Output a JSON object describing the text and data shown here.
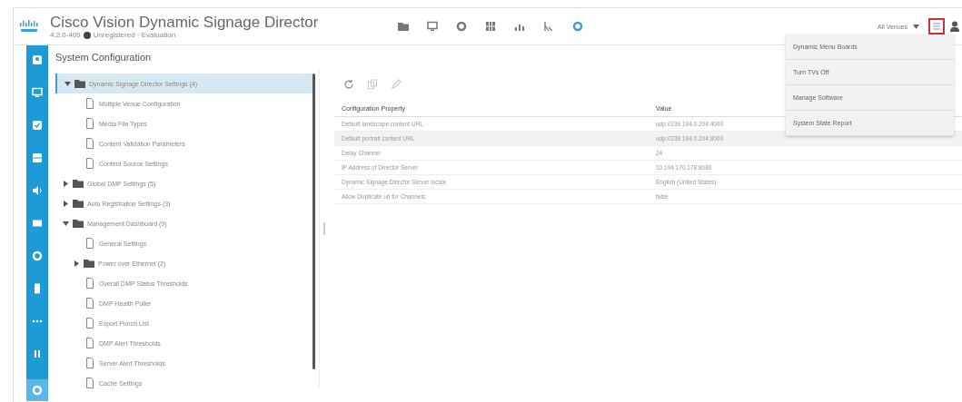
{
  "header": {
    "title": "Cisco Vision Dynamic Signage Director",
    "version": "4.2.0-409",
    "license": "Unregistered · Evaluation",
    "venue_selector": "All Venues"
  },
  "nav_icons": [
    {
      "kind": "folder",
      "selected": false
    },
    {
      "kind": "display",
      "selected": false
    },
    {
      "kind": "gear",
      "selected": false
    },
    {
      "kind": "grid",
      "selected": false
    },
    {
      "kind": "chart",
      "selected": false
    },
    {
      "kind": "signal",
      "selected": false
    },
    {
      "kind": "ring",
      "selected": true
    }
  ],
  "sidebar_icons": [
    {
      "kind": "user",
      "selected": false
    },
    {
      "kind": "display",
      "selected": false
    },
    {
      "kind": "check",
      "selected": false
    },
    {
      "kind": "box",
      "selected": false
    },
    {
      "kind": "sound",
      "selected": false
    },
    {
      "kind": "card",
      "selected": false
    },
    {
      "kind": "ring",
      "selected": false
    },
    {
      "kind": "phone",
      "selected": false
    },
    {
      "kind": "dots",
      "selected": false
    },
    {
      "kind": "pause",
      "selected": false
    },
    {
      "kind": "ring",
      "selected": true
    }
  ],
  "page_title": "System Configuration",
  "tree": [
    {
      "kind": "folder",
      "label": "Dynamic Signage Director Settings (4)",
      "expanded": true,
      "selected": true,
      "children": [
        {
          "kind": "file",
          "label": "Multiple Venue Configuration",
          "selected": false
        },
        {
          "kind": "file",
          "label": "Media File Types",
          "selected": false
        },
        {
          "kind": "file",
          "label": "Content Validation Parameters",
          "selected": false
        },
        {
          "kind": "file",
          "label": "Content Source Settings",
          "selected": false
        }
      ]
    },
    {
      "kind": "folder",
      "label": "Global DMP Settings (5)",
      "expanded": false,
      "selected": false
    },
    {
      "kind": "folder",
      "label": "Auto Registration Settings (3)",
      "expanded": false,
      "selected": false
    },
    {
      "kind": "folder",
      "label": "Management Dashboard (9)",
      "expanded": true,
      "selected": false,
      "children": [
        {
          "kind": "file",
          "label": "General Settings",
          "selected": false
        },
        {
          "kind": "folder",
          "label": "Power over Ethernet (2)",
          "expanded": false,
          "selected": false
        },
        {
          "kind": "file",
          "label": "Overall DMP Status Thresholds",
          "selected": false
        },
        {
          "kind": "file",
          "label": "DMP Health Poller",
          "selected": false
        },
        {
          "kind": "file",
          "label": "Export Punch List",
          "selected": false
        },
        {
          "kind": "file",
          "label": "DMP Alert Thresholds",
          "selected": false
        },
        {
          "kind": "file",
          "label": "Server Alert Thresholds",
          "selected": false
        },
        {
          "kind": "file",
          "label": "Cache Settings",
          "selected": false
        }
      ]
    }
  ],
  "toolbar": [
    {
      "kind": "refresh",
      "disabled": false
    },
    {
      "kind": "copy",
      "disabled": true
    },
    {
      "kind": "edit",
      "disabled": true
    }
  ],
  "table": {
    "columns": [
      "Configuration Property",
      "Value"
    ],
    "rows": [
      {
        "cells": [
          "Default landscape content URL",
          "udp://239.194.0.204:4000"
        ],
        "selected": false
      },
      {
        "cells": [
          "Default portrait content URL",
          "udp://239.194.0.204:8000"
        ],
        "selected": true
      },
      {
        "cells": [
          "Delay Channel",
          "24"
        ],
        "selected": false
      },
      {
        "cells": [
          "IP Address of Director Server",
          "10.194.170.178:8080"
        ],
        "selected": false
      },
      {
        "cells": [
          "Dynamic Signage Director Server locale",
          "English (United States)"
        ],
        "selected": false
      },
      {
        "cells": [
          "Allow Duplicate url for Channels",
          "false"
        ],
        "selected": false
      }
    ]
  },
  "menu": {
    "open": true,
    "items": [
      "Dynamic Menu Boards",
      "Turn TVs Off",
      "Manage Software",
      "System State Report"
    ]
  }
}
